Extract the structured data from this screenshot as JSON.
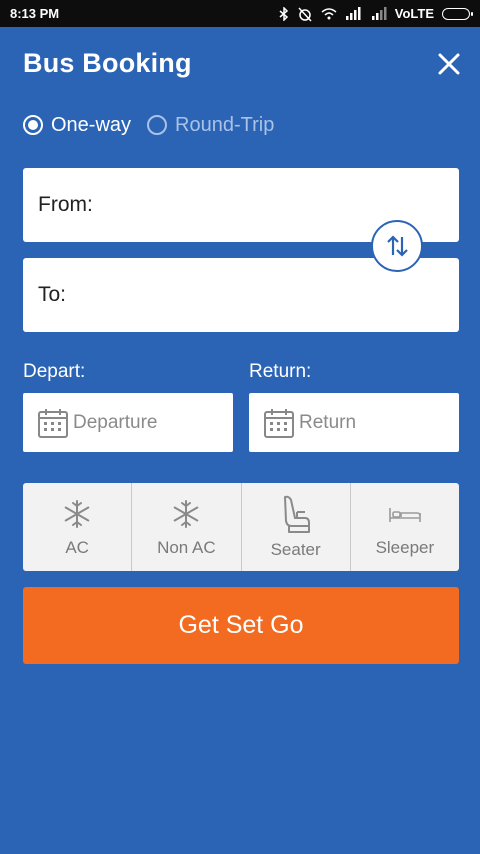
{
  "status_bar": {
    "time": "8:13 PM",
    "network": "VoLTE"
  },
  "header": {
    "title": "Bus Booking",
    "close_icon": "close-icon"
  },
  "trip_type": {
    "options": [
      {
        "label": "One-way",
        "selected": true
      },
      {
        "label": "Round-Trip",
        "selected": false
      }
    ]
  },
  "route": {
    "from_label": "From:",
    "to_label": "To:",
    "swap_icon": "swap-arrows-icon"
  },
  "dates": {
    "depart_label": "Depart:",
    "return_label": "Return:",
    "depart_placeholder": "Departure",
    "return_placeholder": "Return",
    "calendar_icon": "calendar-icon"
  },
  "bus_types": [
    {
      "label": "AC",
      "icon": "snowflake-icon"
    },
    {
      "label": "Non AC",
      "icon": "snowflake-icon"
    },
    {
      "label": "Seater",
      "icon": "seat-icon"
    },
    {
      "label": "Sleeper",
      "icon": "bed-icon"
    }
  ],
  "submit": {
    "label": "Get Set Go"
  },
  "colors": {
    "background": "#2b64b5",
    "primary_button": "#f26b21",
    "card": "#ffffff",
    "type_bg": "#f2f2f2"
  }
}
